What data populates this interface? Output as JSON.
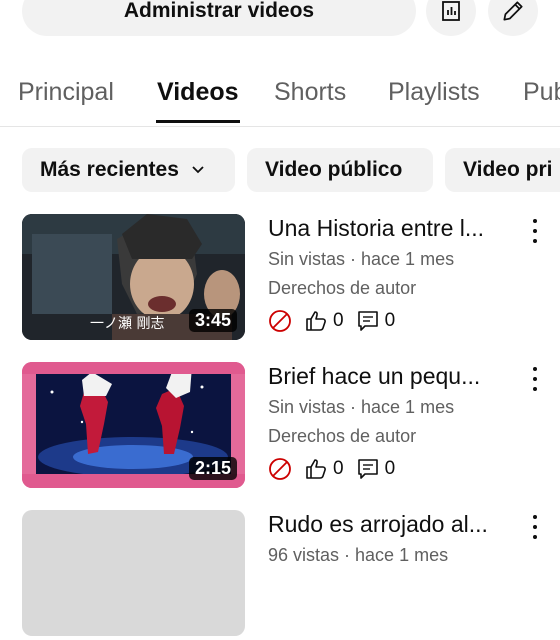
{
  "header": {
    "manage_label": "Administrar videos",
    "analytics_icon": "analytics-icon",
    "edit_icon": "pencil-icon"
  },
  "tabs": [
    {
      "label": "Principal",
      "active": false
    },
    {
      "label": "Videos",
      "active": true
    },
    {
      "label": "Shorts",
      "active": false
    },
    {
      "label": "Playlists",
      "active": false
    },
    {
      "label": "Pub",
      "active": false
    }
  ],
  "filters": [
    {
      "label": "Más recientes",
      "has_dropdown": true
    },
    {
      "label": "Video público",
      "has_dropdown": false
    },
    {
      "label": "Video pri",
      "has_dropdown": false
    }
  ],
  "videos": [
    {
      "title": "Una Historia entre l...",
      "meta": "Sin vistas · hace 1 mes",
      "rights": "Derechos de autor",
      "duration": "3:45",
      "likes": "0",
      "comments": "0"
    },
    {
      "title": "Brief hace un pequ...",
      "meta": "Sin vistas · hace 1 mes",
      "rights": "Derechos de autor",
      "duration": "2:15",
      "likes": "0",
      "comments": "0"
    },
    {
      "title": "Rudo es arrojado al...",
      "meta": "96 vistas · hace 1 mes"
    }
  ],
  "colors": {
    "chip_bg": "#f2f2f2",
    "text_primary": "#0f0f0f",
    "text_secondary": "#606060",
    "restriction_red": "#cc0000",
    "thumb2_pink": "#e05a8f"
  }
}
